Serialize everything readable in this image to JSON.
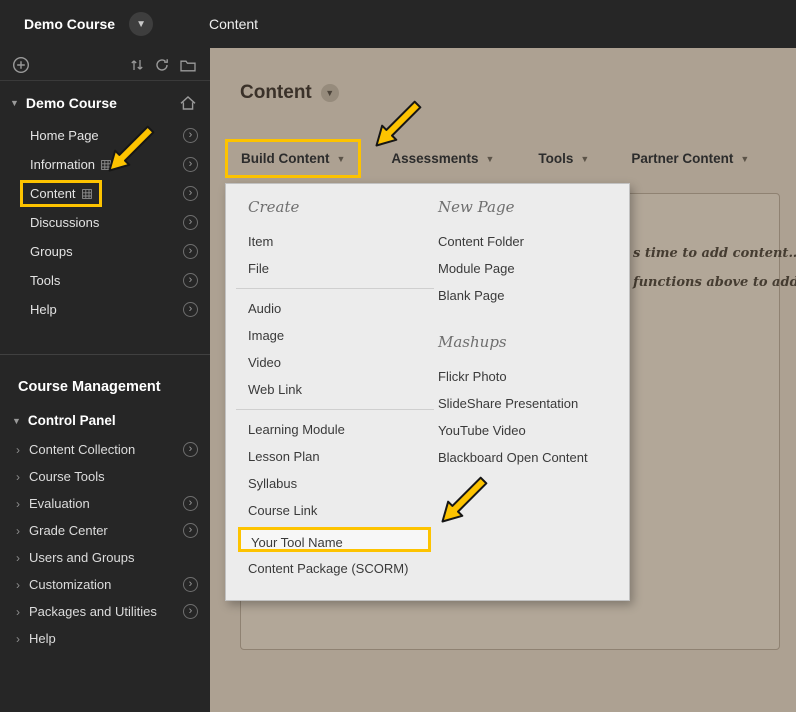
{
  "colors": {
    "accent_yellow": "#fdc300",
    "dark_bar": "#262626",
    "page_bg": "#ada192",
    "menu_bg": "#ececec"
  },
  "topbar": {
    "course_title": "Demo Course",
    "breadcrumb": "Content"
  },
  "sidebar": {
    "course_name": "Demo Course",
    "nav_items": [
      {
        "label": "Home Page"
      },
      {
        "label": "Information"
      },
      {
        "label": "Content"
      },
      {
        "label": "Discussions"
      },
      {
        "label": "Groups"
      },
      {
        "label": "Tools"
      },
      {
        "label": "Help"
      }
    ],
    "management_header": "Course Management",
    "control_panel": "Control Panel",
    "management_items": [
      {
        "label": "Content Collection",
        "has_arrow": true
      },
      {
        "label": "Course Tools",
        "has_arrow": false
      },
      {
        "label": "Evaluation",
        "has_arrow": true
      },
      {
        "label": "Grade Center",
        "has_arrow": true
      },
      {
        "label": "Users and Groups",
        "has_arrow": false
      },
      {
        "label": "Customization",
        "has_arrow": true
      },
      {
        "label": "Packages and Utilities",
        "has_arrow": true
      },
      {
        "label": "Help",
        "has_arrow": false
      }
    ]
  },
  "main": {
    "page_title": "Content",
    "action_bar": {
      "build_content": "Build Content",
      "assessments": "Assessments",
      "tools": "Tools",
      "partner_content": "Partner Content"
    },
    "empty_message_line1": "s time to add content…",
    "empty_message_line2": "functions above to add it."
  },
  "build_menu": {
    "create_header": "Create",
    "create_group1": [
      "Item",
      "File"
    ],
    "create_group2": [
      "Audio",
      "Image",
      "Video",
      "Web Link"
    ],
    "create_group3": [
      "Learning Module",
      "Lesson Plan",
      "Syllabus",
      "Course Link"
    ],
    "tool_item": "Your Tool Name",
    "create_last": "Content Package (SCORM)",
    "new_page_header": "New Page",
    "new_page_items": [
      "Content Folder",
      "Module Page",
      "Blank Page"
    ],
    "mashups_header": "Mashups",
    "mashups_items": [
      "Flickr Photo",
      "SlideShare Presentation",
      "YouTube Video",
      "Blackboard Open Content"
    ]
  }
}
